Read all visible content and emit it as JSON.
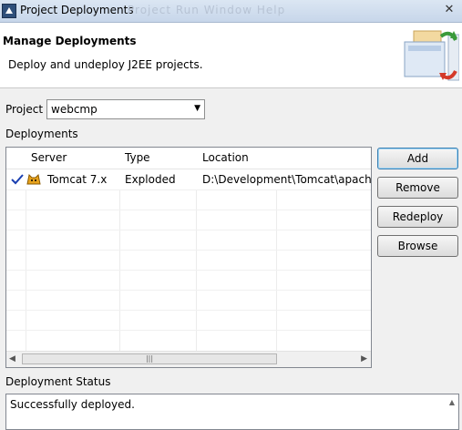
{
  "window": {
    "title": "Project Deployments",
    "ghost_menu": "Project   Run   Window   Help"
  },
  "header": {
    "title": "Manage Deployments",
    "description": "Deploy and undeploy J2EE projects."
  },
  "project": {
    "label": "Project",
    "value": "webcmp"
  },
  "deployments": {
    "label": "Deployments",
    "columns": [
      "Server",
      "Type",
      "Location"
    ],
    "rows": [
      {
        "server": "Tomcat  7.x",
        "type": "Exploded",
        "location": "D:\\Development\\Tomcat\\apache"
      }
    ]
  },
  "buttons": {
    "add": "Add",
    "remove": "Remove",
    "redeploy": "Redeploy",
    "browse": "Browse"
  },
  "status": {
    "label": "Deployment Status",
    "text": "Successfully deployed."
  },
  "colors": {
    "accent": "#3c7fb1",
    "check": "#1a3fb0"
  }
}
